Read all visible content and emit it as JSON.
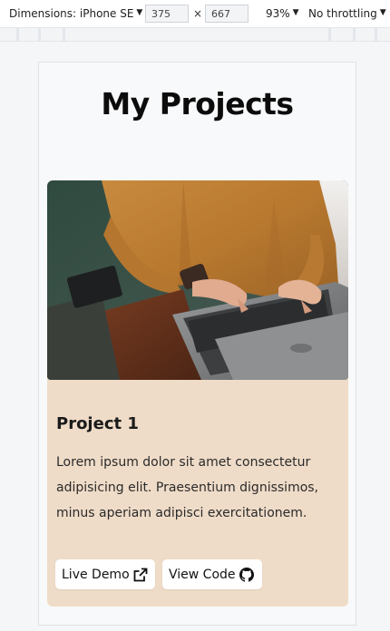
{
  "devtools": {
    "dimensions_label": "Dimensions: iPhone SE",
    "width": "375",
    "separator": "×",
    "height": "667",
    "zoom": "93%",
    "throttling": "No throttling"
  },
  "page": {
    "title": "My Projects"
  },
  "project": {
    "image_alt": "Person typing on a laptop",
    "title": "Project 1",
    "description": "Lorem ipsum dolor sit amet consectetur adipisicing elit. Praesentium dignissimos, minus aperiam adipisci exercitationem.",
    "demo_label": "Live Demo",
    "demo_icon": "external-link-icon",
    "code_label": "View Code",
    "code_icon": "github-icon"
  },
  "colors": {
    "card_bg": "#efdcc8",
    "page_bg": "#f8f9fa"
  }
}
